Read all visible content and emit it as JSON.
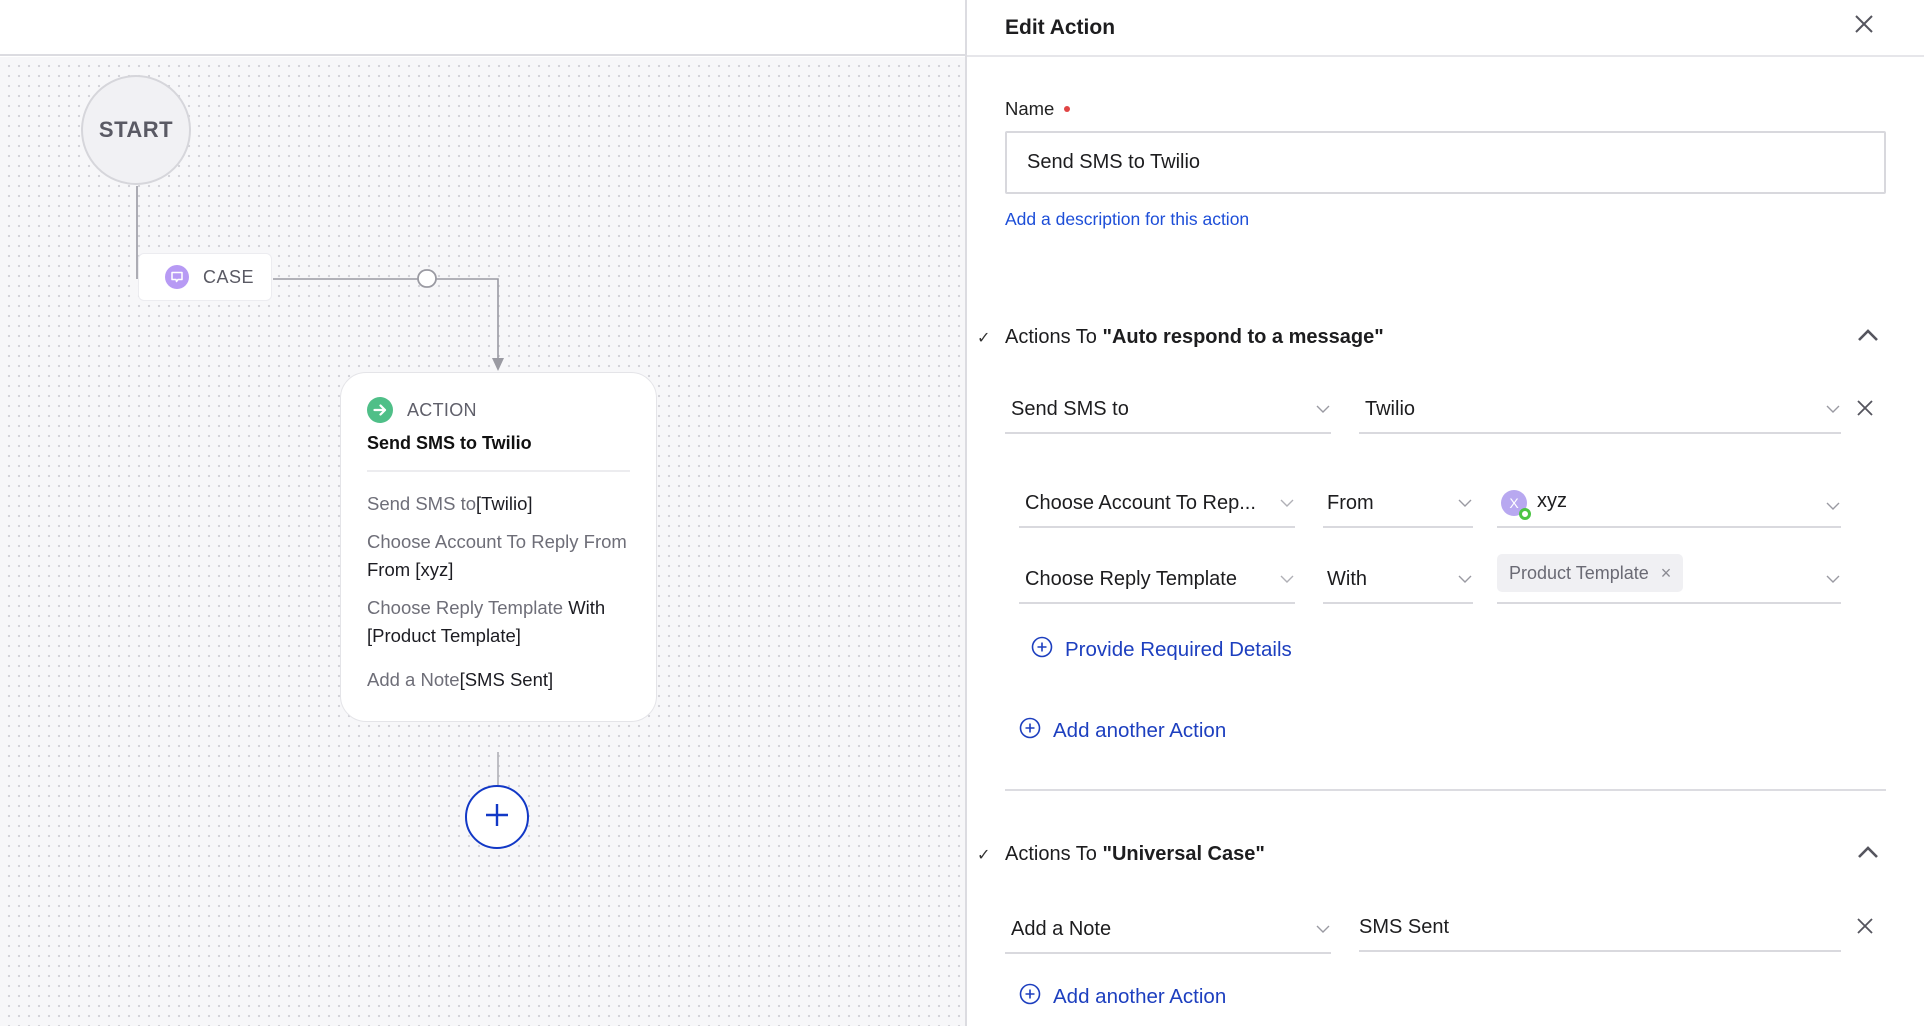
{
  "canvas": {
    "start_label": "START",
    "case_node": {
      "label": "CASE",
      "icon": "chat-bubble-icon",
      "icon_color": "#b79af4"
    },
    "action_node": {
      "type_label": "ACTION",
      "icon": "arrow-right-circle-icon",
      "icon_color": "#4fbf88",
      "title": "Send SMS to Twilio",
      "details": [
        {
          "label": "Send SMS to",
          "value": "[Twilio]"
        },
        {
          "label": "Choose Account To Reply From",
          "value": " From [xyz]"
        },
        {
          "label": "Choose Reply Template",
          "value": " With [Product Template]"
        },
        {
          "label": "Add a Note",
          "value": "[SMS Sent]"
        }
      ]
    },
    "add_node_icon": "plus-icon"
  },
  "panel": {
    "title": "Edit Action",
    "close_icon": "close-icon",
    "name_field": {
      "label": "Name",
      "required": true,
      "value": "Send SMS to Twilio"
    },
    "description_link": "Add a description for this action",
    "sections": [
      {
        "prefix": "Actions To ",
        "target": "\"Auto respond to a message\"",
        "expanded": true,
        "rows": [
          {
            "action": "Send SMS to",
            "value": "Twilio"
          }
        ],
        "sub_rows": [
          {
            "field": "Choose Account To Rep...",
            "operator": "From",
            "value": "xyz",
            "avatar_letter": "X"
          },
          {
            "field": "Choose Reply Template",
            "operator": "With",
            "chip": "Product Template"
          }
        ],
        "provide_details_label": "Provide Required Details",
        "add_action_label": "Add another Action"
      },
      {
        "prefix": "Actions To ",
        "target": "\"Universal Case\"",
        "expanded": true,
        "rows": [
          {
            "action": "Add a Note",
            "value": "SMS Sent"
          }
        ],
        "add_action_label": "Add another Action"
      }
    ]
  },
  "colors": {
    "link_blue": "#1d3fbf",
    "accent_blue": "#1238c6",
    "required_red": "#e04545",
    "presence_green": "#4cc544"
  }
}
